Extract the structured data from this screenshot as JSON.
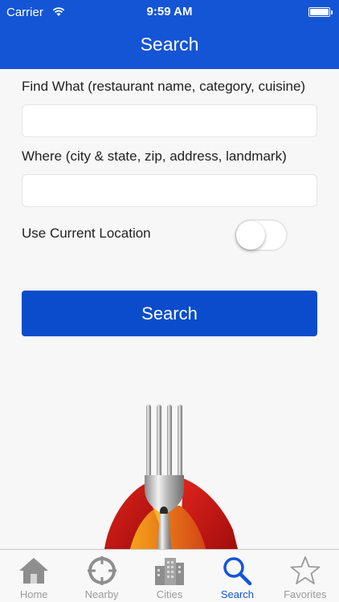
{
  "status_bar": {
    "carrier": "Carrier",
    "time": "9:59 AM"
  },
  "nav": {
    "title": "Search"
  },
  "form": {
    "find_label": "Find What (restaurant name, category, cuisine)",
    "find_value": "",
    "where_label": "Where (city & state, zip, address, landmark)",
    "where_value": "",
    "location_label": "Use Current Location",
    "location_toggle_on": false,
    "search_button": "Search"
  },
  "tabs": [
    {
      "label": "Home",
      "icon": "home-icon",
      "active": false
    },
    {
      "label": "Nearby",
      "icon": "crosshair-icon",
      "active": false
    },
    {
      "label": "Cities",
      "icon": "buildings-icon",
      "active": false
    },
    {
      "label": "Search",
      "icon": "magnifier-icon",
      "active": true
    },
    {
      "label": "Favorites",
      "icon": "star-icon",
      "active": false
    }
  ],
  "colors": {
    "brand": "#1455d6",
    "button": "#0a4ccc",
    "tab_inactive": "#9b9b9b"
  }
}
